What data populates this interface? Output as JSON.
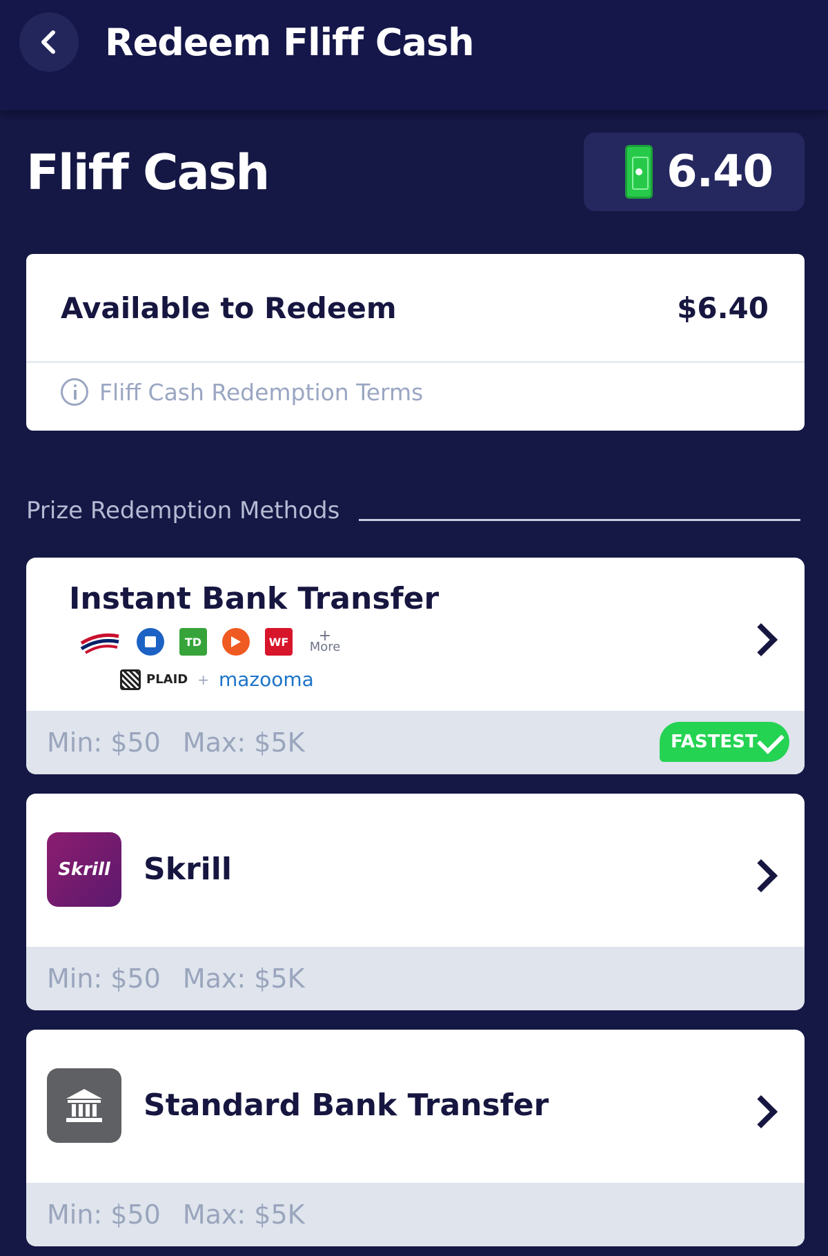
{
  "header": {
    "title": "Redeem Fliff Cash",
    "back_icon": "chevron-left-icon"
  },
  "balance": {
    "title": "Fliff Cash",
    "value": "6.40",
    "icon": "cash-icon"
  },
  "available": {
    "label": "Available to Redeem",
    "value": "$6.40",
    "terms_label": "Fliff Cash Redemption Terms"
  },
  "section": {
    "title": "Prize Redemption Methods"
  },
  "methods": [
    {
      "title": "Instant Bank Transfer",
      "min": "Min: $50",
      "max": "Max: $5K",
      "badge": "FASTEST",
      "bank_icons": [
        "bank-of-america-icon",
        "chase-icon",
        "td-icon",
        "play-icon",
        "wells-fargo-icon"
      ],
      "wf_label": "WF",
      "td_label": "TD",
      "more_label": "More",
      "partner_plaid": "PLAID",
      "partner_mazooma": "mazooma"
    },
    {
      "title": "Skrill",
      "icon_text": "Skrill",
      "min": "Min: $50",
      "max": "Max: $5K"
    },
    {
      "title": "Standard Bank Transfer",
      "min": "Min: $50",
      "max": "Max: $5K"
    }
  ],
  "colors": {
    "background": "#151744",
    "fastest_green": "#25d353",
    "skrill_purple": "#7b1c6f"
  }
}
